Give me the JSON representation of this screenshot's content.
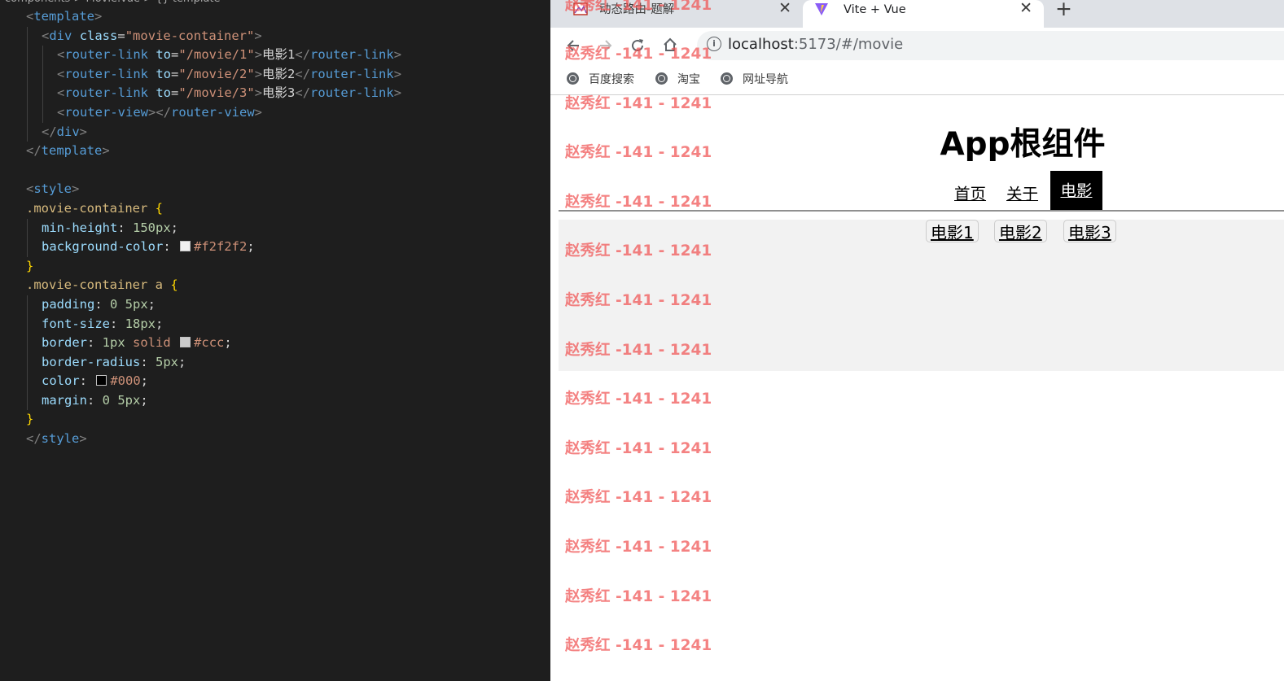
{
  "editor": {
    "breadcrumb": "components > Movie.vue > {} template",
    "code": {
      "template_open": "template",
      "div_tag": "div",
      "div_attr": "class",
      "div_class": "\"movie-container\"",
      "router_link_tag": "router-link",
      "to_attr": "to",
      "links": [
        {
          "to": "\"/movie/1\"",
          "text": "电影1"
        },
        {
          "to": "\"/movie/2\"",
          "text": "电影2"
        },
        {
          "to": "\"/movie/3\"",
          "text": "电影3"
        }
      ],
      "router_view_tag": "router-view",
      "style_tag": "style",
      "sel1": ".movie-container",
      "sel2": ".movie-container a",
      "props1": [
        {
          "name": "min-height",
          "value": "150px"
        },
        {
          "name": "background-color",
          "value": "#f2f2f2",
          "swatch": "#f2f2f2"
        }
      ],
      "props2": [
        {
          "name": "padding",
          "value": "0 5px"
        },
        {
          "name": "font-size",
          "value": "18px"
        },
        {
          "name": "border",
          "value_num": "1px",
          "value_kw": "solid",
          "value": "#ccc",
          "swatch": "#cccccc"
        },
        {
          "name": "border-radius",
          "value": "5px"
        },
        {
          "name": "color",
          "value": "#000",
          "swatch": "#000000"
        },
        {
          "name": "margin",
          "value": "0 5px"
        }
      ]
    }
  },
  "browser": {
    "tabs": [
      {
        "title": "动态路由-题解",
        "close": "✕"
      },
      {
        "title": "Vite + Vue",
        "close": "✕"
      }
    ],
    "new_tab": "+",
    "url_host": "localhost",
    "url_path": ":5173/#/movie",
    "bookmarks": [
      "百度搜索",
      "淘宝",
      "网址导航"
    ]
  },
  "page": {
    "title": "App根组件",
    "nav": [
      "首页",
      "关于",
      "电影"
    ],
    "movie_links": [
      "电影1",
      "电影2",
      "电影3"
    ],
    "watermark": "赵秀红 -141 - 1241"
  },
  "colors": {
    "editor_bg": "#1e1e1e",
    "watermark": "#f05252",
    "active_nav_bg": "#000000",
    "movie_container_bg": "#f2f2f2"
  },
  "icons": [
    "vue-logo-icon",
    "tab-favicon-icon",
    "vite-logo-icon",
    "back-icon",
    "forward-icon",
    "reload-icon",
    "home-icon",
    "site-info-icon",
    "globe-icon"
  ]
}
